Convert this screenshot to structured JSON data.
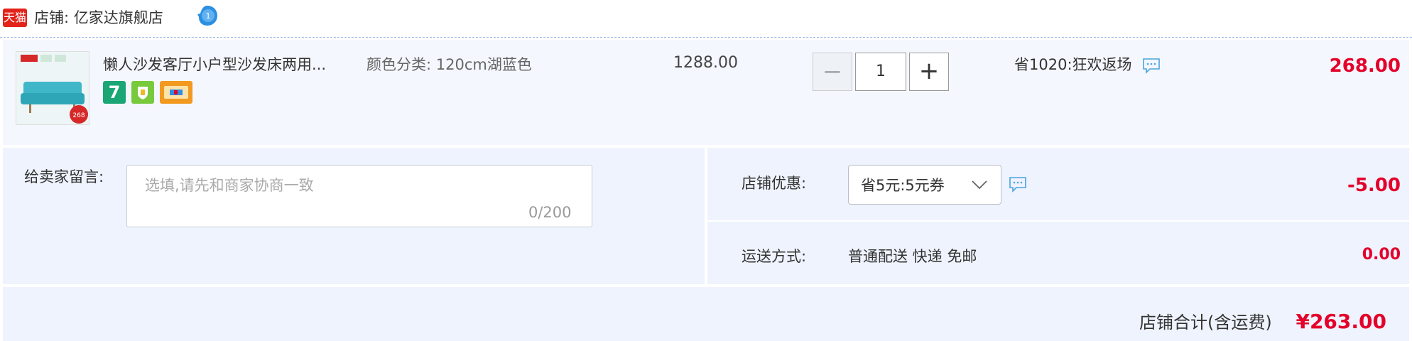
{
  "shop": {
    "brand_badge": "天猫",
    "name": "店铺: 亿家达旗舰店"
  },
  "item": {
    "title": "懒人沙发客厅小户型沙发床两用...",
    "sku": "颜色分类: 120cm湖蓝色",
    "thumb_tag": "268",
    "badge_seven": "7",
    "unit_price": "1288.00",
    "quantity": "1",
    "qty_minus": "−",
    "qty_plus": "+",
    "promo": "省1020:狂欢返场",
    "subtotal": "268.00"
  },
  "message": {
    "label": "给卖家留言:",
    "placeholder": "选填,请先和商家协商一致",
    "counter": "0/200"
  },
  "coupon": {
    "label": "店铺优惠:",
    "selected": "省5元:5元券",
    "amount": "-5.00"
  },
  "shipping": {
    "label": "运送方式:",
    "method": "普通配送 快递 免邮",
    "amount": "0.00"
  },
  "total": {
    "label": "店铺合计(含运费)",
    "amount": "¥263.00"
  },
  "colors": {
    "price_red": "#e4002b",
    "tmall_red": "#e2231a",
    "panel_bg": "#eef3fd"
  },
  "icons": [
    "tmall-logo-icon",
    "wangwang-icon",
    "chat-bubble-icon",
    "chevron-down-icon",
    "seven-day-return-icon",
    "shield-icon",
    "card-icon"
  ]
}
